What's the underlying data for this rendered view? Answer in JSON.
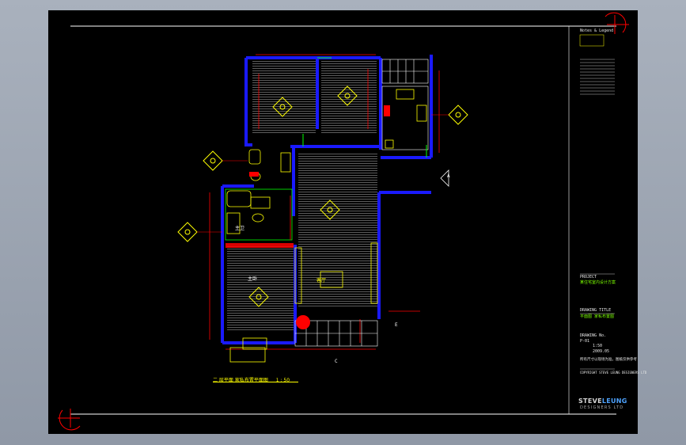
{
  "sheet": {
    "background": "#000000",
    "frame_color": "#ffffff",
    "corner_mark_color": "#ff0000"
  },
  "plan": {
    "wall_color": "#0000cc",
    "floor_line_color": "#c8c8c8",
    "annotation_color": "#ff0000",
    "furniture_color": "#ffff00",
    "fixture_color": "#00ff00",
    "room_labels": [
      "客厅",
      "主卧",
      "主卫"
    ],
    "axis_marks": [
      "A",
      "C",
      "E"
    ],
    "drawing_title": "二 层平面 家私布置平面图",
    "drawing_scale": "1 : 50"
  },
  "titleblock": {
    "notes_heading": "Notes & Legend",
    "project_label": "PROJECT",
    "project_value": "某住宅室内设计方案",
    "drawing_title_label": "DRAWING TITLE",
    "drawing_title_value": "平面图 家私布置图",
    "drawing_no_label": "DRAWING No.",
    "drawing_no_value": "P-01",
    "scale_value": "1:50",
    "date_value": "2009.05",
    "remarks": "所有尺寸以现场为准，图纸仅供参考",
    "copyright": "COPYRIGHT STEVE LEUNG DESIGNERS LTD",
    "brand_primary": "STEVE",
    "brand_accent": "LEUNG",
    "brand_sub": "DESIGNERS LTD"
  }
}
